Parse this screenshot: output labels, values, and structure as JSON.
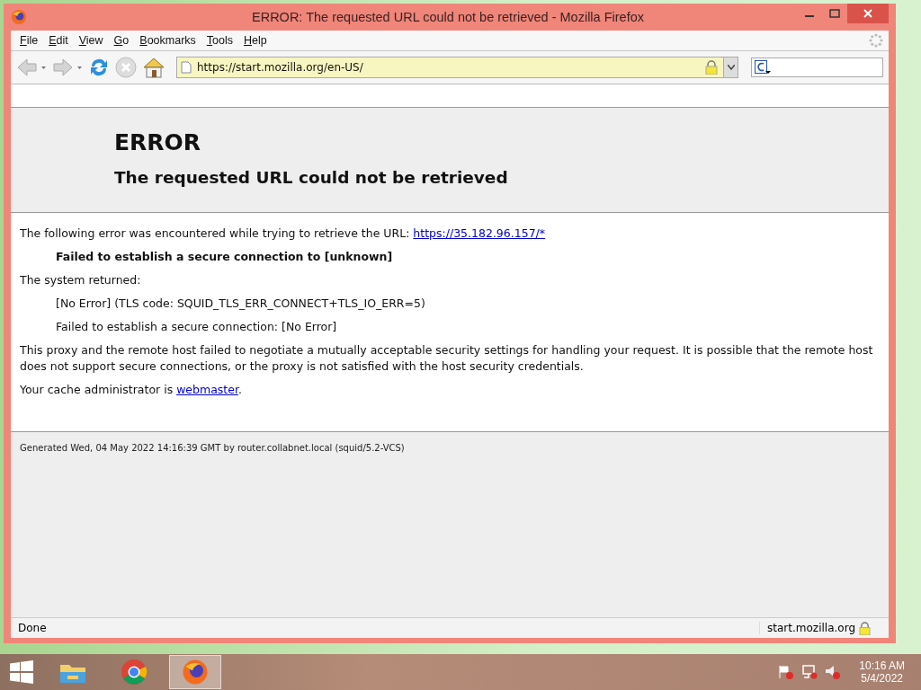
{
  "window": {
    "title": "ERROR: The requested URL could not be retrieved - Mozilla Firefox"
  },
  "menu": [
    {
      "label": "File"
    },
    {
      "label": "Edit"
    },
    {
      "label": "View"
    },
    {
      "label": "Go"
    },
    {
      "label": "Bookmarks"
    },
    {
      "label": "Tools"
    },
    {
      "label": "Help"
    }
  ],
  "toolbar": {
    "url": "https://start.mozilla.org/en-US/",
    "back_disabled": true,
    "forward_disabled": true
  },
  "page": {
    "heading": "ERROR",
    "subheading": "The requested URL could not be retrieved",
    "blocks": [
      {
        "kind": "para",
        "text": "The following error was encountered while trying to retrieve the URL: ",
        "link": "https://35.182.96.157/*"
      },
      {
        "kind": "bold_indent",
        "text": "Failed to establish a secure connection to [unknown]"
      },
      {
        "kind": "para",
        "text": "The system returned:"
      },
      {
        "kind": "indent",
        "text": "[No Error] (TLS code: SQUID_TLS_ERR_CONNECT+TLS_IO_ERR=5)"
      },
      {
        "kind": "indent",
        "text": "Failed to establish a secure connection: [No Error]"
      },
      {
        "kind": "para",
        "text": "This proxy and the remote host failed to negotiate a mutually acceptable security settings for handling your request. It is possible that the remote host does not support secure connections, or the proxy is not satisfied with the host security credentials."
      },
      {
        "kind": "para",
        "text": "Your cache administrator is ",
        "link": "webmaster",
        "after": "."
      }
    ],
    "footer": "Generated Wed, 04 May 2022 14:16:39 GMT by router.collabnet.local (squid/5.2-VCS)"
  },
  "status_bar": {
    "text": "Done",
    "host": "start.mozilla.org"
  },
  "taskbar": {
    "apps": [
      {
        "kind": "explorer",
        "selected": false
      },
      {
        "kind": "chrome",
        "selected": false
      },
      {
        "kind": "firefox",
        "selected": true
      }
    ],
    "time": "10:16 AM",
    "date": "5/4/2022"
  }
}
